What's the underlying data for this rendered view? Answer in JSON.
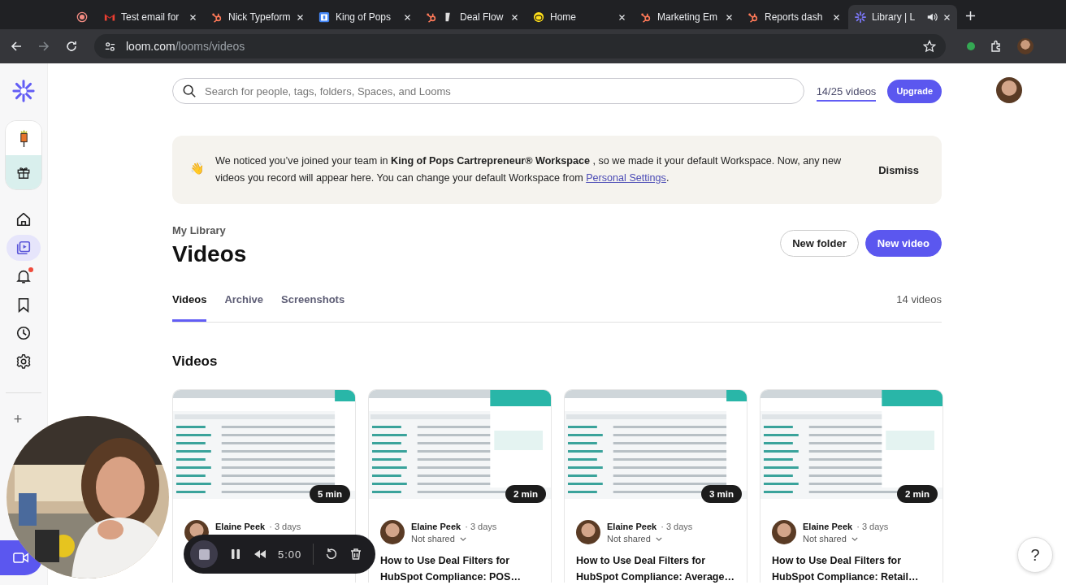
{
  "browser": {
    "tabs": [
      {
        "kind": "record",
        "selected": false
      },
      {
        "kind": "mail",
        "title": "Test email for",
        "selected": false
      },
      {
        "kind": "sprocket",
        "title": "Nick Typeform",
        "selected": false
      },
      {
        "kind": "calendar",
        "title": "King of Pops",
        "selected": false
      },
      {
        "kind": "sprocket-doc",
        "title": "Deal Flow",
        "selected": false
      },
      {
        "kind": "chimp",
        "title": "Home",
        "selected": false
      },
      {
        "kind": "sprocket",
        "title": "Marketing Em",
        "selected": false
      },
      {
        "kind": "sprocket",
        "title": "Reports dash",
        "selected": false
      },
      {
        "kind": "loom",
        "title": "Library | L",
        "selected": true,
        "audio": true
      }
    ],
    "url_host": "loom.com",
    "url_path": "/looms/videos"
  },
  "sidebar": {
    "items": [
      {
        "kind": "home",
        "selected": false,
        "badge": false
      },
      {
        "kind": "library",
        "selected": true,
        "badge": false
      },
      {
        "kind": "bell",
        "selected": false,
        "badge": true
      },
      {
        "kind": "bookmark",
        "selected": false,
        "badge": false
      },
      {
        "kind": "clock",
        "selected": false,
        "badge": false
      },
      {
        "kind": "gear",
        "selected": false,
        "badge": false
      }
    ],
    "add": "+"
  },
  "topbar": {
    "search_placeholder": "Search for people, tags, folders, Spaces, and Looms",
    "usage": "14/25 videos",
    "upgrade": "Upgrade"
  },
  "banner": {
    "emoji": "👋",
    "text_before": "We noticed you’ve joined your team in **King of Pops Cartrepreneur® Workspace** , so we made it your default Workspace. Now, any new videos you record will appear here. You can change your default Workspace from ",
    "link": "Personal Settings",
    "text_after": ".",
    "dismiss": "Dismiss"
  },
  "header": {
    "breadcrumb": "My Library",
    "title": "Videos",
    "buttons": [
      {
        "label": "New folder",
        "kind": "secondary"
      },
      {
        "label": "New video",
        "kind": "primary"
      }
    ]
  },
  "tabs": [
    {
      "label": "Videos",
      "selected": true
    },
    {
      "label": "Archive",
      "selected": false
    },
    {
      "label": "Screenshots",
      "selected": false
    }
  ],
  "count": "14 videos",
  "section_title": "Videos",
  "videos": [
    {
      "duration": "5 min",
      "author": "Elaine Peek",
      "age": "· 3 days"
    },
    {
      "duration": "2 min",
      "author": "Elaine Peek",
      "age": "· 3 days",
      "sharing": "Not shared",
      "title": "How to Use Deal Filters for HubSpot Compliance: POS…"
    },
    {
      "duration": "3 min",
      "author": "Elaine Peek",
      "age": "· 3 days",
      "sharing": "Not shared",
      "title": "How to Use Deal Filters for HubSpot Compliance: Average…"
    },
    {
      "duration": "2 min",
      "author": "Elaine Peek",
      "age": "· 3 days",
      "sharing": "Not shared",
      "title": "How to Use Deal Filters for HubSpot Compliance: Retail…"
    }
  ],
  "recorder": {
    "time": "5:00"
  },
  "help": "?"
}
